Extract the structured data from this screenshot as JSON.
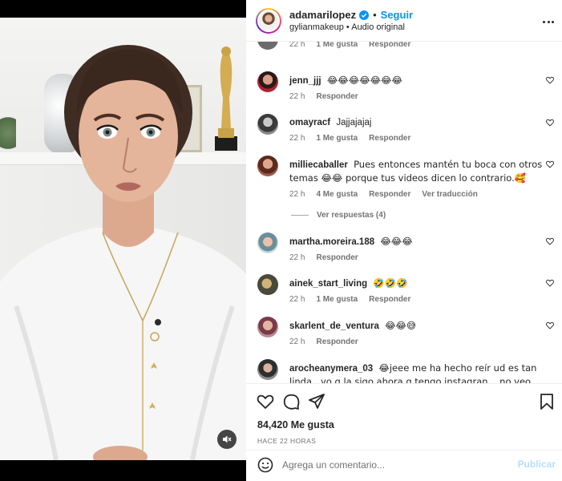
{
  "header": {
    "username": "adamarilopez",
    "separator": "•",
    "follow_label": "Seguir",
    "subtitle": "gylianmakeup • Audio original"
  },
  "comments": [
    {
      "id": "top-partial",
      "username": "",
      "text": "",
      "time": "22 h",
      "likes": "1 Me gusta",
      "reply": "Responder",
      "avatar_color": "#6b6b6b"
    },
    {
      "id": "jenn",
      "username": "jenn_jjj",
      "text": "😂😂😂😂😂😂😂",
      "time": "22 h",
      "reply": "Responder",
      "avatar_color": "#3a2a2a"
    },
    {
      "id": "omayracf",
      "username": "omayracf",
      "text": "Jajjajajaj",
      "time": "22 h",
      "likes": "1 Me gusta",
      "reply": "Responder",
      "avatar_color": "#7a7a7a"
    },
    {
      "id": "milliecaballer",
      "username": "milliecaballer",
      "text": "Pues entonces mantén tu boca con otros temas 😂😂 porque tus videos dicen lo contrario.🥰",
      "time": "22 h",
      "likes": "4 Me gusta",
      "reply": "Responder",
      "translate": "Ver traducción",
      "replies": "Ver respuestas (4)",
      "avatar_color": "#8a4b3a"
    },
    {
      "id": "martha",
      "username": "martha.moreira.188",
      "text": "😂😂😂",
      "time": "22 h",
      "reply": "Responder",
      "avatar_color": "#5c8a9c"
    },
    {
      "id": "ainek",
      "username": "ainek_start_living",
      "text": "🤣🤣🤣",
      "time": "22 h",
      "likes": "1 Me gusta",
      "reply": "Responder",
      "avatar_color": "#4a4a3a"
    },
    {
      "id": "skarlent",
      "username": "skarlent_de_ventura",
      "text": "😂😂😅",
      "time": "22 h",
      "reply": "Responder",
      "avatar_color": "#9b6a7a"
    },
    {
      "id": "arocheanymera",
      "username": "arocheanymera_03",
      "text": "😂jeee me ha hecho reír ud es tan linda.. yo q la sigo ahora q tengo instagran... no veo nada d indirectas",
      "avatar_color": "#555555"
    }
  ],
  "actions": {
    "icons": [
      "heart-icon",
      "comment-icon",
      "share-icon",
      "save-icon"
    ]
  },
  "likes_count": "84,420 Me gusta",
  "time_ago": "HACE 22 HORAS",
  "composer": {
    "placeholder": "Agrega un comentario...",
    "publish_label": "Publicar"
  },
  "colors": {
    "accent": "#0095f6",
    "publish_disabled": "#b2dffc",
    "secondary_text": "#737373"
  }
}
